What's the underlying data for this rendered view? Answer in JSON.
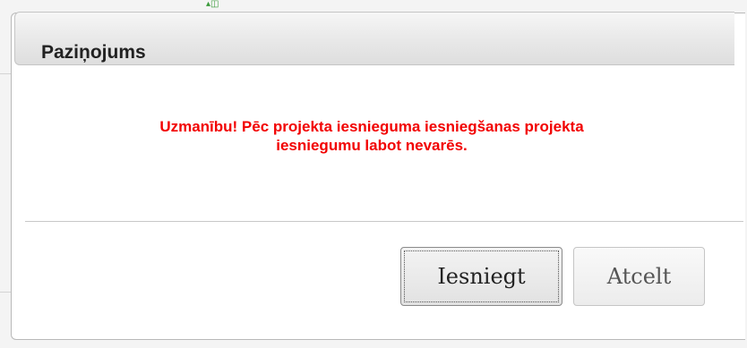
{
  "dialog": {
    "title": "Paziņojums",
    "message_line1": "Uzmanību! Pēc projekta iesnieguma iesniegšanas projekta",
    "message_line2": "iesniegumu labot nevarēs.",
    "buttons": {
      "submit_label": "Iesniegt",
      "cancel_label": "Atcelt"
    }
  },
  "colors": {
    "warning_text": "#f20000",
    "title_text": "#222222"
  }
}
